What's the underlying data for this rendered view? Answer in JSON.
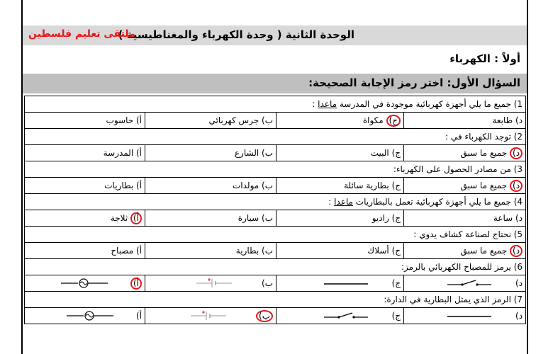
{
  "header": {
    "unit_title": "الوحدة الثانية ( وحدة الكهرباء والمغناطيسية )",
    "brand": "ملتقى تعليم فلسطين"
  },
  "section": {
    "title": "أولاً : الكهرباء"
  },
  "question1": {
    "title": "السؤال الأول: اختر رمز الإجابة الصحيحة:"
  },
  "items": [
    {
      "stem_before": "1) جميع ما يلي أجهزة كهربائية موجودة في المدرسة ",
      "stem_underlined": "ماعدا",
      "stem_after": " :",
      "options": [
        {
          "letter": "أ)",
          "text": "حاسوب"
        },
        {
          "letter": "ب)",
          "text": "جرس كهربائي"
        },
        {
          "letter": "ج)",
          "text": "مكواة"
        },
        {
          "letter": "د)",
          "text": "طابعة"
        }
      ],
      "circled": 2
    },
    {
      "stem_before": "2) توجد الكهرباء في :",
      "stem_underlined": "",
      "stem_after": "",
      "options": [
        {
          "letter": "أ)",
          "text": "المدرسة"
        },
        {
          "letter": "ب)",
          "text": "الشارع"
        },
        {
          "letter": "ج)",
          "text": "البيت"
        },
        {
          "letter": "د)",
          "text": "جميع ما سبق"
        }
      ],
      "circled": 3
    },
    {
      "stem_before": "3) من مصادر الحصول على الكهرباء:",
      "stem_underlined": "",
      "stem_after": "",
      "options": [
        {
          "letter": "أ)",
          "text": "بطاريات"
        },
        {
          "letter": "ب)",
          "text": "مولدات"
        },
        {
          "letter": "ج)",
          "text": "بطارية سائلة"
        },
        {
          "letter": "د)",
          "text": "جميع ما سبق"
        }
      ],
      "circled": 3
    },
    {
      "stem_before": "4) جميع ما يلي أجهزة كهربائية تعمل بالبطاريات ",
      "stem_underlined": "ماعدا",
      "stem_after": " :",
      "options": [
        {
          "letter": "أ)",
          "text": "ثلاجة"
        },
        {
          "letter": "ب)",
          "text": "سيارة"
        },
        {
          "letter": "ج)",
          "text": "راديو"
        },
        {
          "letter": "د)",
          "text": "ساعة"
        }
      ],
      "circled": 0
    },
    {
      "stem_before": "5) نحتاج لصناعة كشاف يدوي :",
      "stem_underlined": "",
      "stem_after": "",
      "options": [
        {
          "letter": "أ)",
          "text": "مصباح"
        },
        {
          "letter": "ب)",
          "text": "بطارية"
        },
        {
          "letter": "ج)",
          "text": "أسلاك"
        },
        {
          "letter": "د)",
          "text": "جميع ما سبق"
        }
      ],
      "circled": 3
    },
    {
      "stem_before": "6) يرمز للمصباح الكهربائي بالرمز:",
      "stem_underlined": "",
      "stem_after": "",
      "options": [
        {
          "letter": "أ)",
          "text": "",
          "symbol": "lamp"
        },
        {
          "letter": "ب)",
          "text": "",
          "symbol": "battery"
        },
        {
          "letter": "ج)",
          "text": "",
          "symbol": "wire"
        },
        {
          "letter": "د)",
          "text": "",
          "symbol": "switch"
        }
      ],
      "circled": 0
    },
    {
      "stem_before": "7) الرمز الذي يمثل البطارية في الدارة:",
      "stem_underlined": "",
      "stem_after": "",
      "options": [
        {
          "letter": "أ)",
          "text": "",
          "symbol": "lamp"
        },
        {
          "letter": "ب)",
          "text": "",
          "symbol": "battery"
        },
        {
          "letter": "ج)",
          "text": "",
          "symbol": "switch"
        },
        {
          "letter": "د)",
          "text": "",
          "symbol": "wire"
        }
      ],
      "circled": 1
    }
  ],
  "colors": {
    "accent_red": "#e8161c",
    "band_light": "#d9d9d9",
    "band_dark": "#bfbfbf"
  }
}
